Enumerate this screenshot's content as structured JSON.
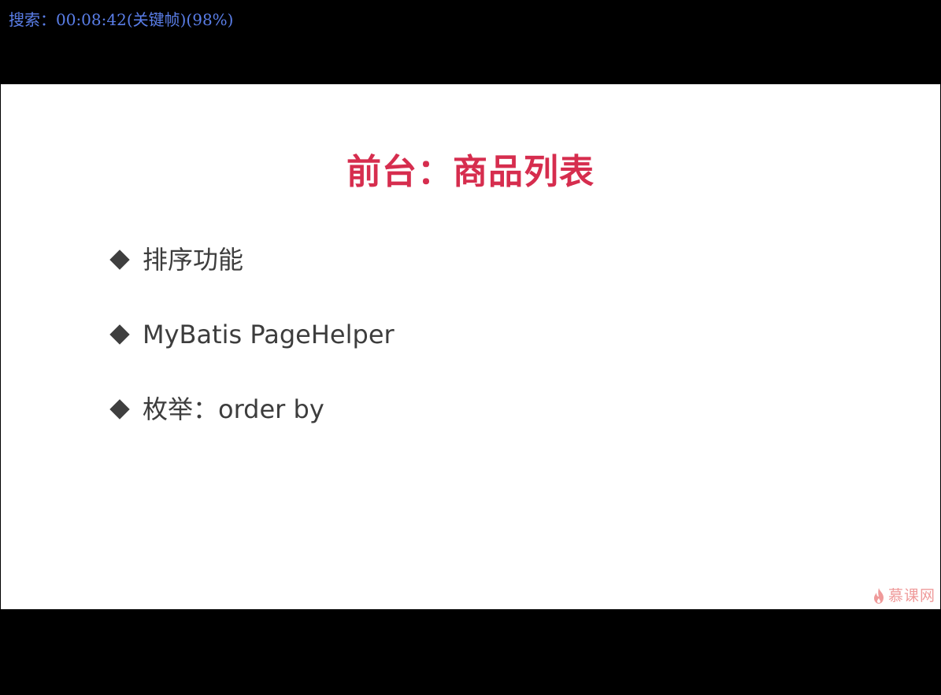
{
  "overlay": {
    "search_text": "搜索：00:08:42(关键帧)(98%)"
  },
  "slide": {
    "title": "前台：商品列表",
    "bullets": [
      {
        "text": "排序功能"
      },
      {
        "text": "MyBatis PageHelper"
      },
      {
        "text": "枚举：order by"
      }
    ]
  },
  "logo": {
    "text": "慕课网",
    "icon": "flame-icon"
  },
  "colors": {
    "title": "#d62d4e",
    "bullet_text": "#3d3d3d",
    "overlay_text": "#5a7ee8",
    "logo": "#ef9a9a"
  }
}
